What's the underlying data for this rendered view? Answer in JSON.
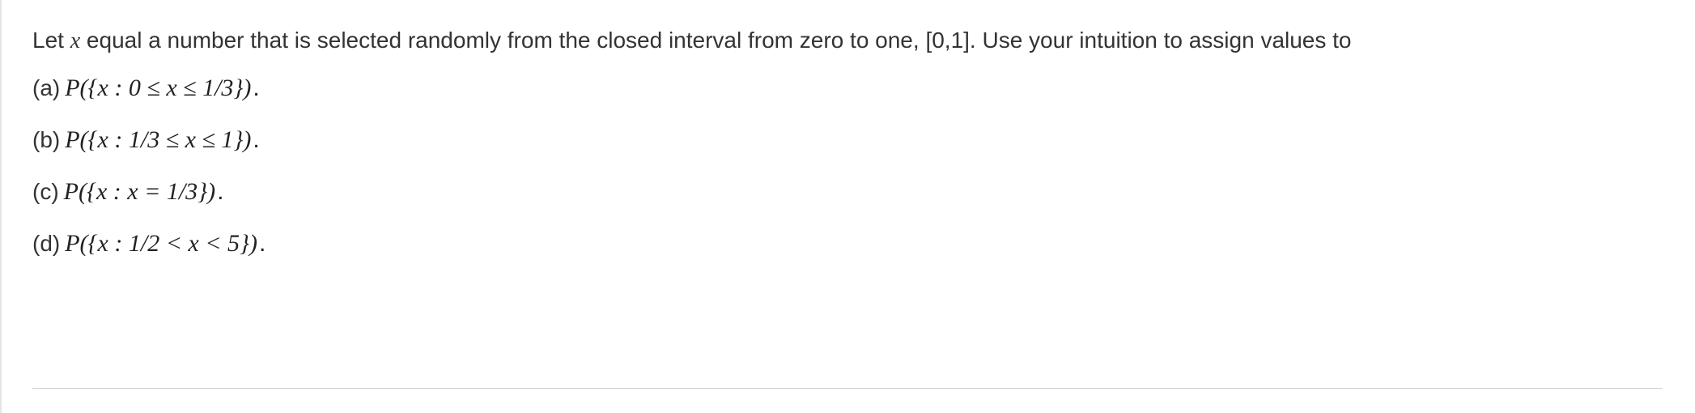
{
  "intro": {
    "prefix": "Let ",
    "variable": "x",
    "rest": " equal a number that is selected randomly from the closed interval from zero to one, [0,1]. Use your intuition to assign values to"
  },
  "items": [
    {
      "label": "(a)",
      "expression": "P({x : 0 ≤ x ≤ 1/3})"
    },
    {
      "label": "(b)",
      "expression": "P({x : 1/3 ≤ x ≤ 1})"
    },
    {
      "label": "(c)",
      "expression": "P({x : x = 1/3})"
    },
    {
      "label": "(d)",
      "expression": "P({x : 1/2 < x < 5})"
    }
  ],
  "period": "."
}
